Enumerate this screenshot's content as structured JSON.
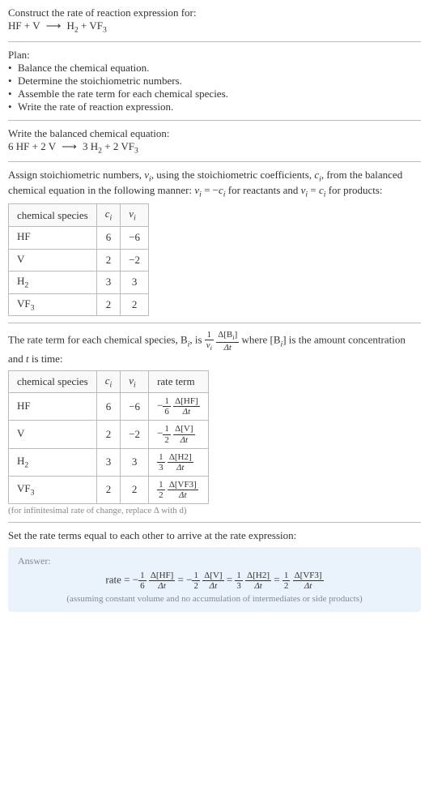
{
  "intro": {
    "line1": "Construct the rate of reaction expression for:",
    "eq_lhs1": "HF + V",
    "eq_rhs1a": "H",
    "eq_rhs1a_sub": "2",
    "eq_plus1": " + VF",
    "eq_rhs1b_sub": "3"
  },
  "plan": {
    "heading": "Plan:",
    "b1": "Balance the chemical equation.",
    "b2": "Determine the stoichiometric numbers.",
    "b3": "Assemble the rate term for each chemical species.",
    "b4": "Write the rate of reaction expression."
  },
  "balanced": {
    "heading": "Write the balanced chemical equation:",
    "lhs": "6 HF + 2 V",
    "rhs_a": "3 H",
    "rhs_a_sub": "2",
    "rhs_b": " + 2 VF",
    "rhs_b_sub": "3"
  },
  "assign": {
    "text1": "Assign stoichiometric numbers, ",
    "nu_i": "ν",
    "nu_i_sub": "i",
    "text2": ", using the stoichiometric coefficients, ",
    "c_i": "c",
    "c_i_sub": "i",
    "text3": ", from the balanced chemical equation in the following manner: ",
    "eq1_l": "ν",
    "eq1_l_sub": "i",
    "eq1_m": " = −",
    "eq1_r": "c",
    "eq1_r_sub": "i",
    "text4": " for reactants and ",
    "eq2_l": "ν",
    "eq2_l_sub": "i",
    "eq2_m": " = ",
    "eq2_r": "c",
    "eq2_r_sub": "i",
    "text5": " for products:"
  },
  "table1": {
    "h1": "chemical species",
    "h2": "c",
    "h2_sub": "i",
    "h3": "ν",
    "h3_sub": "i",
    "rows": [
      {
        "sp": "HF",
        "sub": "",
        "c": "6",
        "nu": "−6"
      },
      {
        "sp": "V",
        "sub": "",
        "c": "2",
        "nu": "−2"
      },
      {
        "sp": "H",
        "sub": "2",
        "c": "3",
        "nu": "3"
      },
      {
        "sp": "VF",
        "sub": "3",
        "c": "2",
        "nu": "2"
      }
    ]
  },
  "rateterm": {
    "text1": "The rate term for each chemical species, B",
    "bi_sub": "i",
    "text2": ", is ",
    "frac1_num": "1",
    "frac1_den_a": "ν",
    "frac1_den_sub": "i",
    "frac2_num_a": "Δ[B",
    "frac2_num_sub": "i",
    "frac2_num_b": "]",
    "frac2_den": "Δt",
    "text3": " where [B",
    "text3_sub": "i",
    "text4": "] is the amount concentration and ",
    "t": "t",
    "text5": " is time:"
  },
  "table2": {
    "h1": "chemical species",
    "h2": "c",
    "h2_sub": "i",
    "h3": "ν",
    "h3_sub": "i",
    "h4": "rate term",
    "rows": [
      {
        "sp": "HF",
        "sub": "",
        "c": "6",
        "nu": "−6",
        "sign": "−",
        "fnum": "1",
        "fden": "6",
        "dnum": "Δ[HF]",
        "dden": "Δt"
      },
      {
        "sp": "V",
        "sub": "",
        "c": "2",
        "nu": "−2",
        "sign": "−",
        "fnum": "1",
        "fden": "2",
        "dnum": "Δ[V]",
        "dden": "Δt"
      },
      {
        "sp": "H",
        "sub": "2",
        "c": "3",
        "nu": "3",
        "sign": "",
        "fnum": "1",
        "fden": "3",
        "dnum": "Δ[H2]",
        "dden": "Δt"
      },
      {
        "sp": "VF",
        "sub": "3",
        "c": "2",
        "nu": "2",
        "sign": "",
        "fnum": "1",
        "fden": "2",
        "dnum": "Δ[VF3]",
        "dden": "Δt"
      }
    ],
    "note": "(for infinitesimal rate of change, replace Δ with d)"
  },
  "final": {
    "heading": "Set the rate terms equal to each other to arrive at the rate expression:",
    "answer_label": "Answer:",
    "rate_word": "rate = ",
    "t1_sign": "−",
    "t1_fnum": "1",
    "t1_fden": "6",
    "t1_dnum": "Δ[HF]",
    "t1_dden": "Δt",
    "eq": " = ",
    "t2_sign": "−",
    "t2_fnum": "1",
    "t2_fden": "2",
    "t2_dnum": "Δ[V]",
    "t2_dden": "Δt",
    "t3_sign": "",
    "t3_fnum": "1",
    "t3_fden": "3",
    "t3_dnum": "Δ[H2]",
    "t3_dden": "Δt",
    "t4_sign": "",
    "t4_fnum": "1",
    "t4_fden": "2",
    "t4_dnum": "Δ[VF3]",
    "t4_dden": "Δt",
    "assume": "(assuming constant volume and no accumulation of intermediates or side products)"
  }
}
